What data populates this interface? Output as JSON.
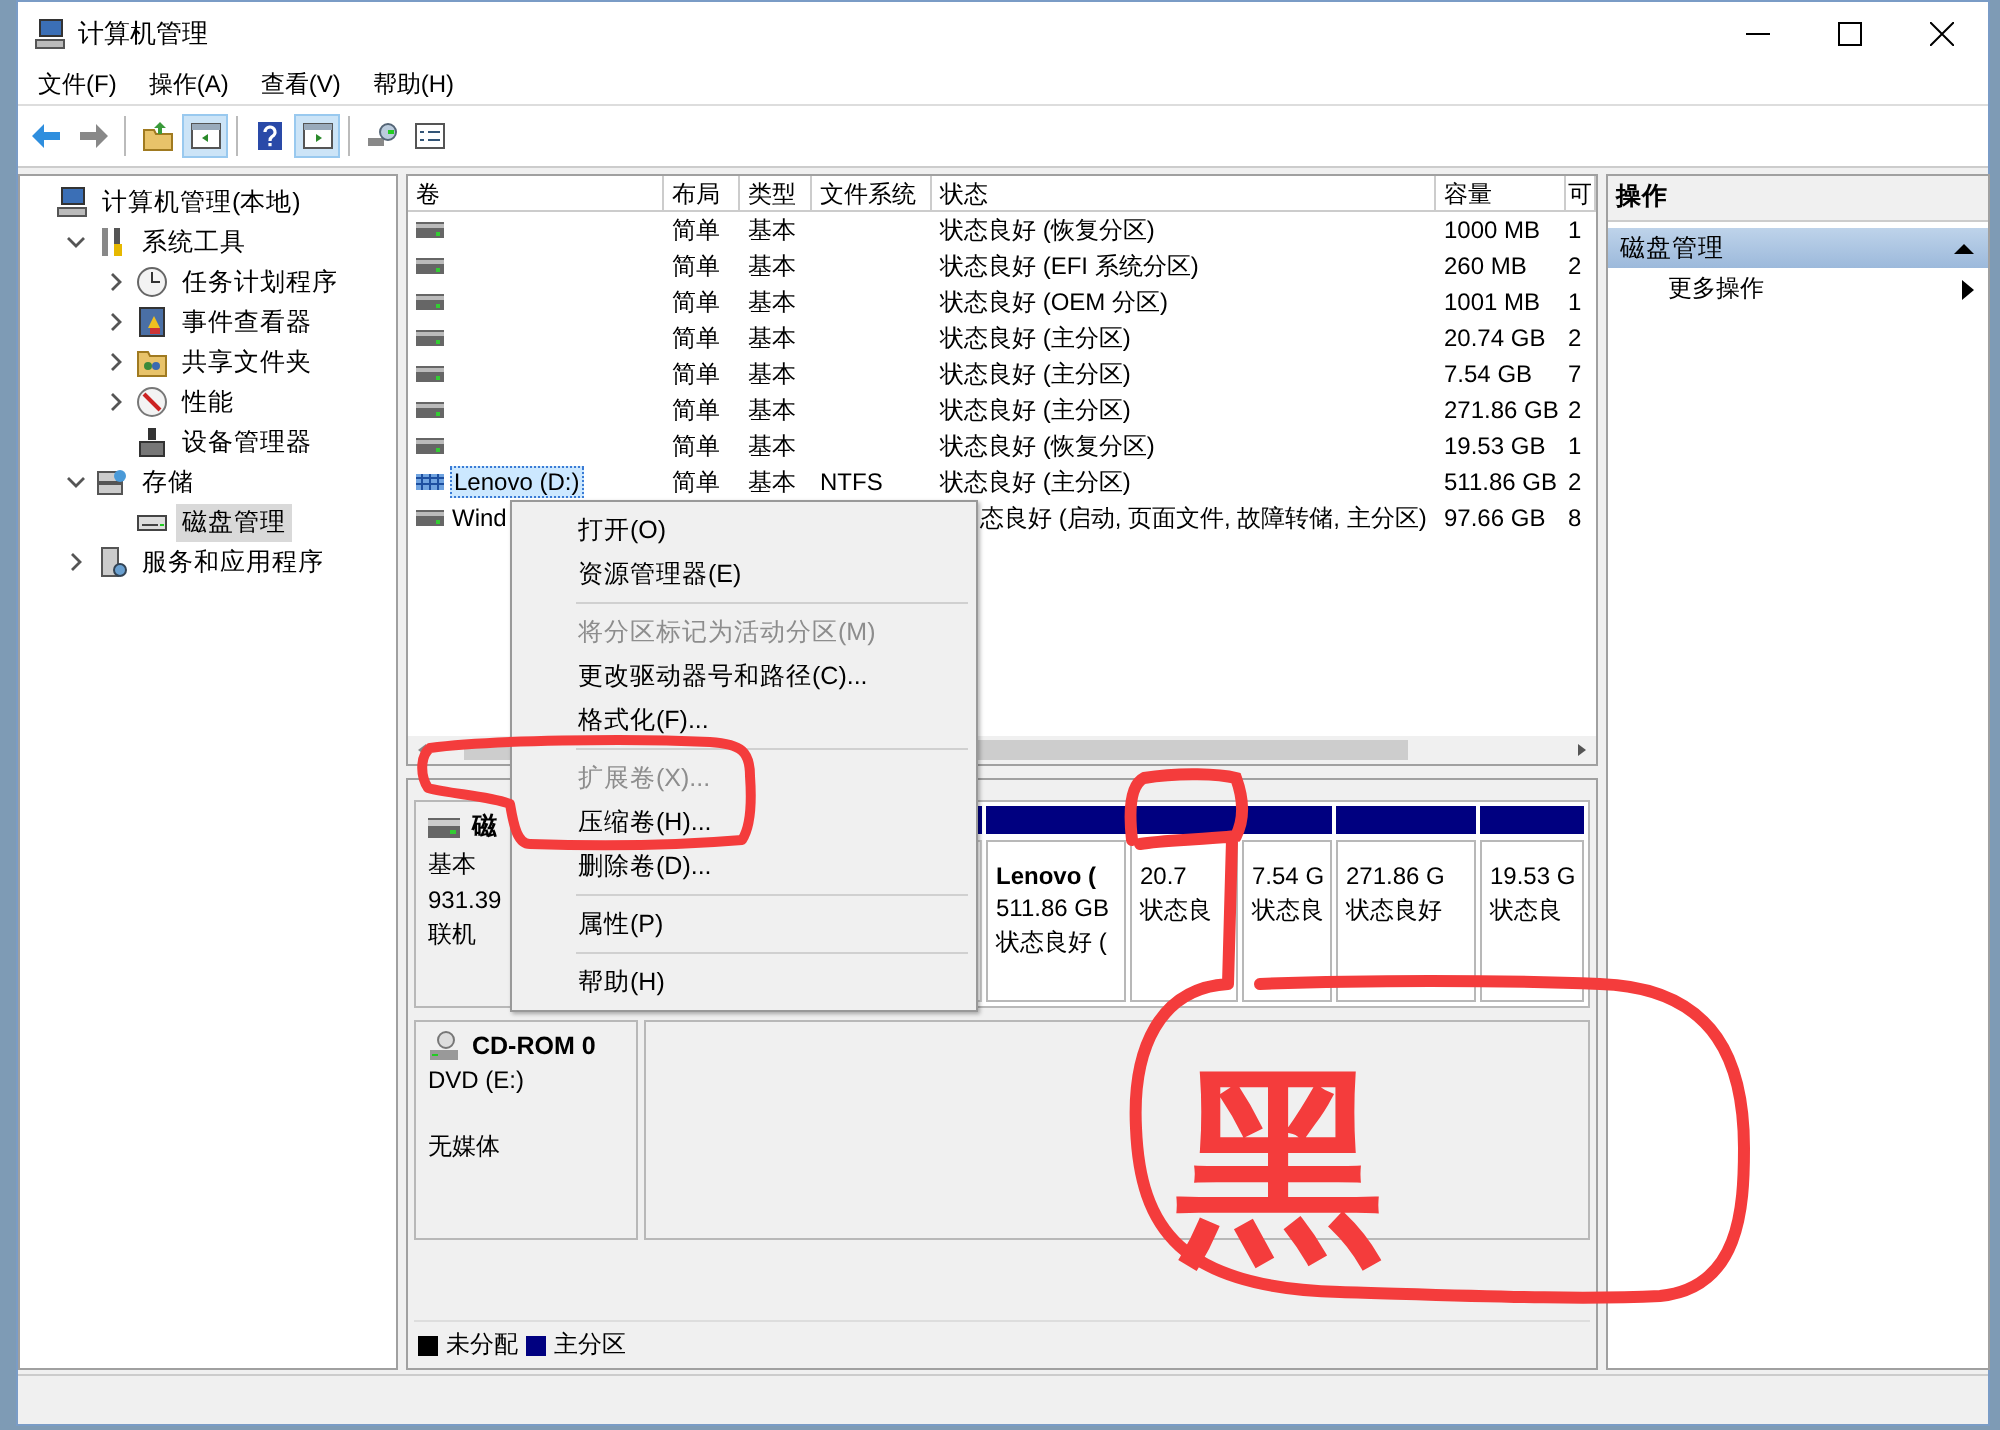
{
  "window": {
    "title": "计算机管理"
  },
  "menu": [
    "文件(F)",
    "操作(A)",
    "查看(V)",
    "帮助(H)"
  ],
  "toolbar": [
    {
      "kind": "back",
      "selected": false
    },
    {
      "kind": "forward",
      "selected": false
    },
    {
      "kind": "up",
      "selected": false
    },
    {
      "kind": "tree",
      "selected": true
    },
    {
      "kind": "help",
      "selected": false
    },
    {
      "kind": "pane",
      "selected": true
    },
    {
      "kind": "connect",
      "selected": false
    },
    {
      "kind": "props",
      "selected": false
    }
  ],
  "tree": [
    {
      "label": "计算机管理(本地)",
      "kind": "computer",
      "selected": false,
      "children": [
        {
          "label": "系统工具",
          "kind": "tools",
          "selected": false,
          "expanded": true,
          "children": [
            {
              "label": "任务计划程序",
              "kind": "clock",
              "selected": false,
              "expanded": false
            },
            {
              "label": "事件查看器",
              "kind": "log",
              "selected": false,
              "expanded": false
            },
            {
              "label": "共享文件夹",
              "kind": "share",
              "selected": false,
              "expanded": false
            },
            {
              "label": "性能",
              "kind": "perf",
              "selected": false,
              "expanded": false
            },
            {
              "label": "设备管理器",
              "kind": "device",
              "selected": false
            }
          ]
        },
        {
          "label": "存储",
          "kind": "storage",
          "selected": false,
          "expanded": true,
          "children": [
            {
              "label": "磁盘管理",
              "kind": "disk",
              "selected": true
            }
          ]
        },
        {
          "label": "服务和应用程序",
          "kind": "services",
          "selected": false,
          "expanded": false
        }
      ]
    }
  ],
  "volumes": {
    "columns": [
      "卷",
      "布局",
      "类型",
      "文件系统",
      "状态",
      "容量",
      "可"
    ],
    "rows": [
      {
        "kind": "disk",
        "selected": false,
        "under_menu": false,
        "layout": "简单",
        "type": "基本",
        "status": "状态良好 (恢复分区)",
        "capacity": "1000 MB",
        "column_7": "1"
      },
      {
        "kind": "disk",
        "selected": false,
        "under_menu": false,
        "layout": "简单",
        "type": "基本",
        "status": "状态良好 (EFI 系统分区)",
        "capacity": "260 MB",
        "column_7": "2"
      },
      {
        "kind": "disk",
        "selected": false,
        "under_menu": false,
        "layout": "简单",
        "type": "基本",
        "status": "状态良好 (OEM 分区)",
        "capacity": "1001 MB",
        "column_7": "1"
      },
      {
        "kind": "disk",
        "selected": false,
        "under_menu": false,
        "layout": "简单",
        "type": "基本",
        "status": "状态良好 (主分区)",
        "capacity": "20.74 GB",
        "column_7": "2"
      },
      {
        "kind": "disk",
        "selected": false,
        "under_menu": false,
        "layout": "简单",
        "type": "基本",
        "status": "状态良好 (主分区)",
        "capacity": "7.54 GB",
        "column_7": "7"
      },
      {
        "kind": "disk",
        "selected": false,
        "under_menu": false,
        "layout": "简单",
        "type": "基本",
        "status": "状态良好 (主分区)",
        "capacity": "271.86 GB",
        "column_7": "2"
      },
      {
        "kind": "disk",
        "selected": false,
        "under_menu": false,
        "layout": "简单",
        "type": "基本",
        "status": "状态良好 (恢复分区)",
        "capacity": "19.53 GB",
        "column_7": "1"
      },
      {
        "kind": "striped",
        "selected": true,
        "under_menu": false,
        "name": "Lenovo (D:)",
        "layout": "简单",
        "type": "基本",
        "filesystem": "NTFS",
        "status": "状态良好 (主分区)",
        "capacity": "511.86 GB",
        "column_7": "2"
      },
      {
        "kind": "disk",
        "selected": false,
        "under_menu": true,
        "name": "Wind",
        "status": "态良好 (启动, 页面文件, 故障转储, 主分区)",
        "capacity": "97.66 GB",
        "column_7": "8"
      }
    ]
  },
  "disks": [
    {
      "kind": "disk",
      "name": "磁",
      "type": "基本",
      "size": "931.39",
      "state": "联机",
      "partitions": [
        {
          "name": "Lenovo (",
          "size": "511.86 GB",
          "status": "状态良好 ("
        },
        {
          "size": "20.7",
          "status": "状态良"
        },
        {
          "size": "7.54 G",
          "status": "状态良"
        },
        {
          "size": "271.86 G",
          "status": "状态良好"
        },
        {
          "size": "19.53 G",
          "status": "状态良"
        }
      ]
    },
    {
      "kind": "cdrom",
      "name": "CD-ROM 0",
      "type": "DVD (E:)",
      "state": "无媒体"
    }
  ],
  "legend": [
    {
      "label": "未分配",
      "color": "#000000"
    },
    {
      "label": "主分区",
      "color": "#000080"
    }
  ],
  "actions": {
    "title": "操作",
    "section": "磁盘管理",
    "items": [
      "更多操作"
    ]
  },
  "context_menu": [
    {
      "kind": "item",
      "label": "打开(O)",
      "disabled": false
    },
    {
      "kind": "item",
      "label": "资源管理器(E)",
      "disabled": false
    },
    {
      "kind": "separator"
    },
    {
      "kind": "item",
      "label": "将分区标记为活动分区(M)",
      "disabled": true
    },
    {
      "kind": "item",
      "label": "更改驱动器号和路径(C)...",
      "disabled": false
    },
    {
      "kind": "item",
      "label": "格式化(F)...",
      "disabled": false
    },
    {
      "kind": "separator"
    },
    {
      "kind": "item",
      "label": "扩展卷(X)...",
      "disabled": true
    },
    {
      "kind": "item",
      "label": "压缩卷(H)...",
      "disabled": false
    },
    {
      "kind": "item",
      "label": "删除卷(D)...",
      "disabled": false
    },
    {
      "kind": "separator"
    },
    {
      "kind": "item",
      "label": "属性(P)",
      "disabled": false
    },
    {
      "kind": "separator"
    },
    {
      "kind": "item",
      "label": "帮助(H)",
      "disabled": false
    }
  ],
  "annotation": {
    "text": "黑"
  }
}
